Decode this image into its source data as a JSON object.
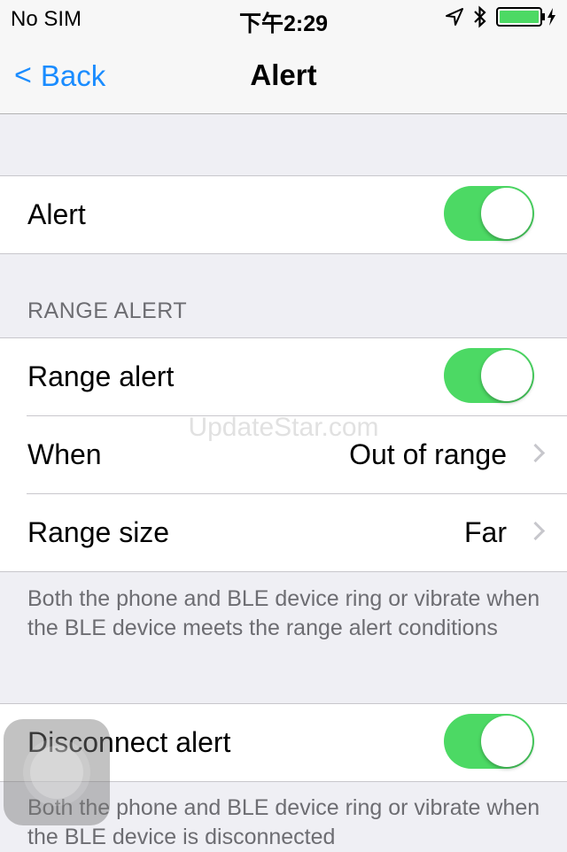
{
  "status_bar": {
    "carrier": "No SIM",
    "time": "下午2:29",
    "battery_color": "#4cd964"
  },
  "nav": {
    "back_label": "Back",
    "back_chevron": "<",
    "title": "Alert"
  },
  "alert_group": {
    "label": "Alert",
    "toggle_on": true
  },
  "range_section": {
    "header": "RANGE ALERT",
    "rows": [
      {
        "label": "Range alert",
        "toggle_on": true
      },
      {
        "label": "When",
        "value": "Out of range"
      },
      {
        "label": "Range size",
        "value": "Far"
      }
    ],
    "footer": "Both the phone and BLE device ring or vibrate when the BLE device meets the range alert conditions"
  },
  "disconnect_section": {
    "label": "Disconnect alert",
    "toggle_on": true,
    "footer": "Both the phone and BLE device ring or vibrate when the BLE device is disconnected"
  },
  "watermark": "UpdateStar.com",
  "colors": {
    "accent": "#1a8cff",
    "switch_on": "#4cd964",
    "background": "#efeff4"
  }
}
